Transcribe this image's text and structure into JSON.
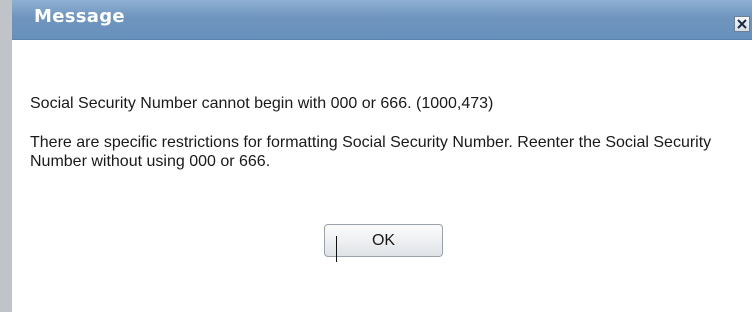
{
  "dialog": {
    "title": "Message",
    "close_glyph": "×"
  },
  "message": {
    "line1": "Social Security Number cannot begin with 000 or 666. (1000,473)",
    "line2": "There are specific restrictions for formatting Social Security Number. Reenter the Social Security Number without using 000 or 666."
  },
  "buttons": {
    "ok_label": "OK"
  },
  "icons": {
    "close": "close-icon"
  },
  "colors": {
    "titlebar": "#6f95be",
    "title_text": "#ffffff",
    "body_text": "#1a1a1a"
  }
}
